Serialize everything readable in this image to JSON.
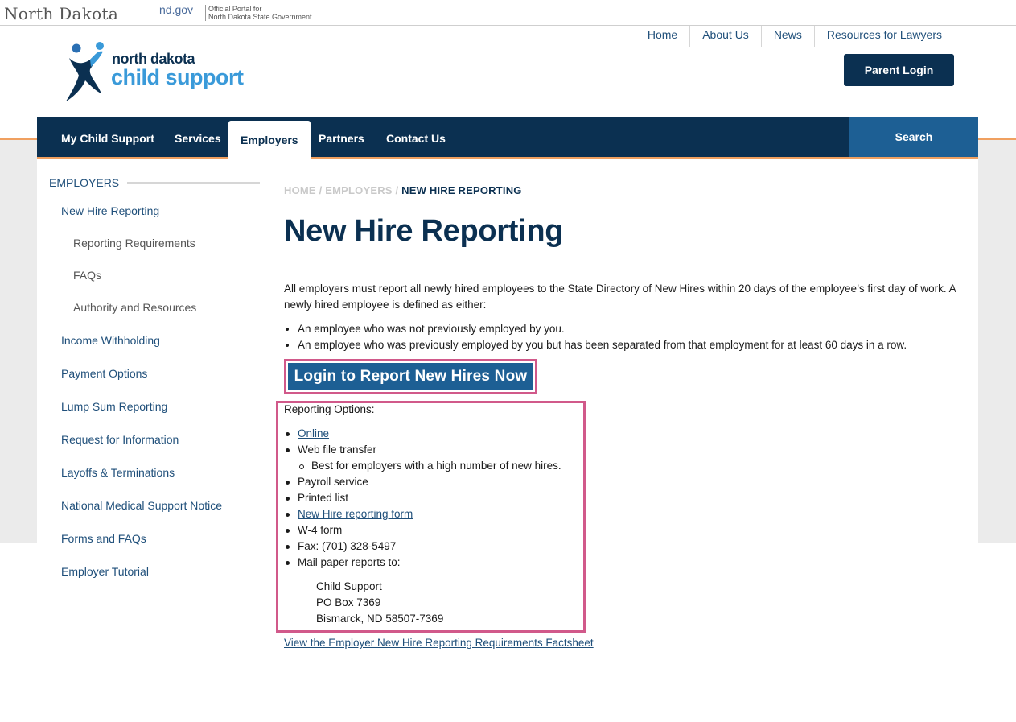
{
  "statebar": {
    "state_name": "North Dakota",
    "ndgov": "nd.gov",
    "portal_line1": "Official Portal for",
    "portal_line2": "North Dakota State Government"
  },
  "utility_nav": [
    "Home",
    "About Us",
    "News",
    "Resources for Lawyers"
  ],
  "logo": {
    "line1": "north dakota",
    "line2": "child support"
  },
  "parent_login": "Parent Login",
  "main_nav": {
    "items": [
      "My Child Support",
      "Services",
      "Employers",
      "Partners",
      "Contact Us"
    ],
    "active": "Employers",
    "search": "Search"
  },
  "sidebar": {
    "heading": "EMPLOYERS",
    "items": [
      {
        "label": "New Hire Reporting",
        "level": 1
      },
      {
        "label": "Reporting Requirements",
        "level": 2
      },
      {
        "label": "FAQs",
        "level": 2
      },
      {
        "label": "Authority and Resources",
        "level": 2
      },
      {
        "label": "Income Withholding",
        "level": 1
      },
      {
        "label": "Payment Options",
        "level": 1
      },
      {
        "label": "Lump Sum Reporting",
        "level": 1
      },
      {
        "label": "Request for Information",
        "level": 1
      },
      {
        "label": "Layoffs & Terminations",
        "level": 1
      },
      {
        "label": "National Medical Support Notice",
        "level": 1
      },
      {
        "label": "Forms and FAQs",
        "level": 1
      },
      {
        "label": "Employer Tutorial",
        "level": 1
      }
    ]
  },
  "breadcrumb": {
    "home": "HOME",
    "sep": "/",
    "employers": "EMPLOYERS",
    "current": "NEW HIRE REPORTING"
  },
  "page_title": "New Hire Reporting",
  "intro": "All employers must report all newly hired employees to the State Directory of New Hires within 20 days of the employee’s first day of work. A newly hired employee is defined as either:",
  "definitions": [
    "An employee who was not previously employed by you.",
    "An employee who was previously employed by you but has been separated from that employment for at least 60 days in a row."
  ],
  "login_button": "Login to Report New Hires Now",
  "reporting_options": {
    "label": "Reporting Options:",
    "online": "Online",
    "web_file": "Web file transfer",
    "web_file_note": "Best for employers with a high number of new hires.",
    "payroll": "Payroll service",
    "printed": "Printed list",
    "form_link": "New Hire reporting form",
    "w4": "W-4 form",
    "fax": "Fax: (701) 328-5497",
    "mail": "Mail paper reports to:",
    "address": [
      "Child Support",
      "PO Box 7369",
      "Bismarck, ND 58507-7369"
    ]
  },
  "factsheet_link": "View the Employer New Hire Reporting Requirements Factsheet",
  "colors": {
    "navy": "#0b3051",
    "blue": "#1d5f94",
    "accent_orange": "#f0a060",
    "highlight_pink": "#d1598a",
    "logo_blue": "#3a9ad9"
  }
}
